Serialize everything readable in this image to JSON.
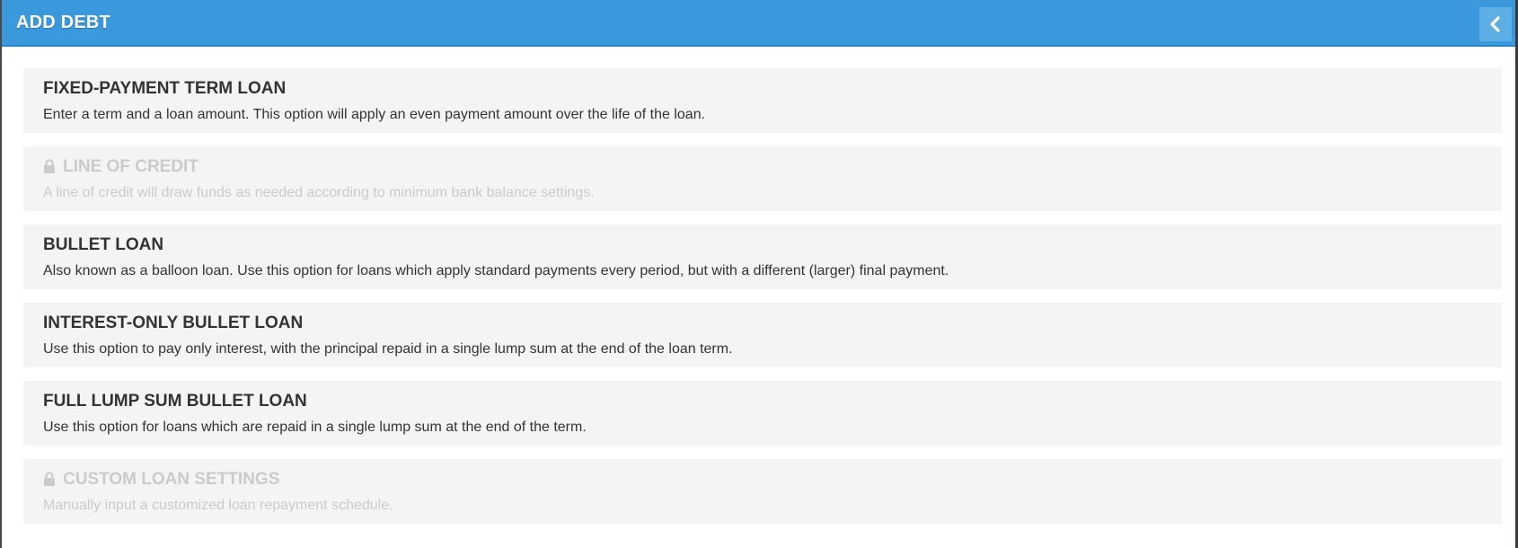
{
  "header": {
    "title": "ADD DEBT",
    "back_icon": "chevron-left-icon",
    "accent_color": "#3a98dc"
  },
  "options": [
    {
      "title": "FIXED-PAYMENT TERM LOAN",
      "description": "Enter a term and a loan amount. This option will apply an even payment amount over the life of the loan.",
      "locked": false
    },
    {
      "title": "LINE OF CREDIT",
      "description": "A line of credit will draw funds as needed according to minimum bank balance settings.",
      "locked": true,
      "icon": "lock-icon"
    },
    {
      "title": "BULLET LOAN",
      "description": "Also known as a balloon loan. Use this option for loans which apply standard payments every period, but with a different (larger) final payment.",
      "locked": false
    },
    {
      "title": "INTEREST-ONLY BULLET LOAN",
      "description": "Use this option to pay only interest, with the principal repaid in a single lump sum at the end of the loan term.",
      "locked": false
    },
    {
      "title": "FULL LUMP SUM BULLET LOAN",
      "description": "Use this option for loans which are repaid in a single lump sum at the end of the term.",
      "locked": false
    },
    {
      "title": "CUSTOM LOAN SETTINGS",
      "description": "Manually input a customized loan repayment schedule.",
      "locked": true,
      "icon": "lock-icon"
    }
  ]
}
